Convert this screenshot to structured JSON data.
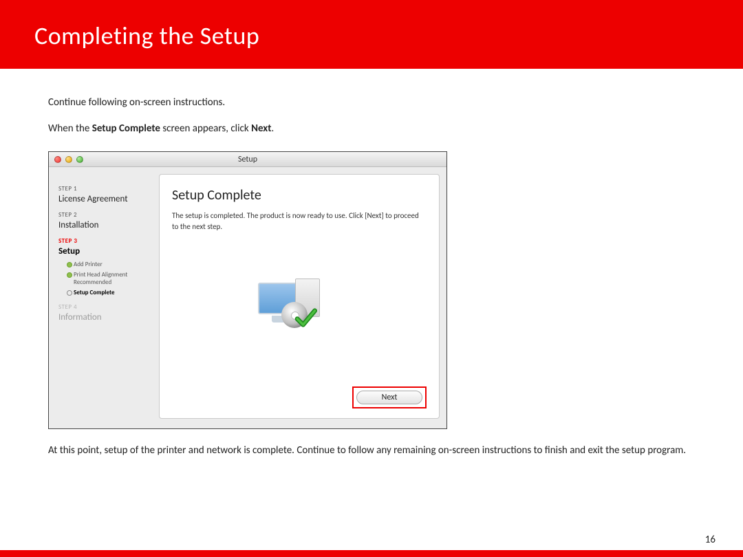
{
  "header": {
    "title": "Completing  the Setup"
  },
  "intro": {
    "line1": "Continue following on-screen instructions.",
    "line2_pre": "When the  ",
    "line2_bold1": "Setup Complete",
    "line2_mid": " screen appears, click ",
    "line2_bold2": "Next",
    "line2_post": "."
  },
  "window": {
    "title": "Setup",
    "steps": {
      "s1_label": "STEP 1",
      "s1_name": "License Agreement",
      "s2_label": "STEP 2",
      "s2_name": "Installation",
      "s3_label": "STEP 3",
      "s3_name": "Setup",
      "s4_label": "STEP 4",
      "s4_name": "Information",
      "sub1": "Add Printer",
      "sub2": "Print Head Alignment Recommended",
      "sub3": "Setup Complete"
    },
    "pane": {
      "title": "Setup Complete",
      "desc": "The setup is completed. The product is now ready to use. Click [Next] to proceed to the next step.",
      "next_label": "Next"
    }
  },
  "post": "At this point, setup of the printer and network is complete.  Continue to follow any remaining on-screen instructions to finish and exit the setup program.",
  "page_number": "16"
}
